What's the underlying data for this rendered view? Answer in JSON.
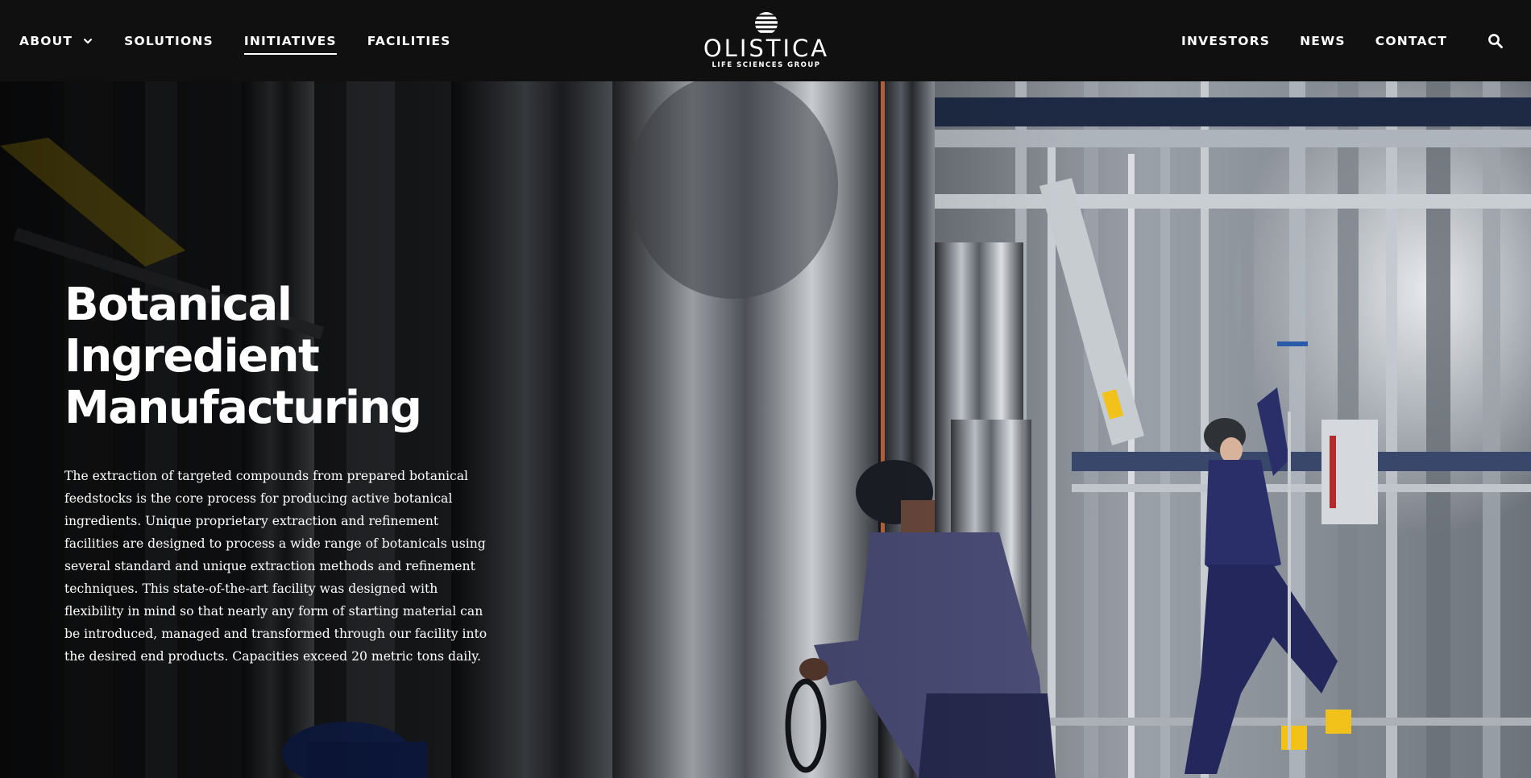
{
  "nav": {
    "left": [
      {
        "label": "ABOUT",
        "has_dropdown": true
      },
      {
        "label": "SOLUTIONS"
      },
      {
        "label": "INITIATIVES",
        "active": true
      },
      {
        "label": "FACILITIES"
      }
    ],
    "right": [
      {
        "label": "INVESTORS"
      },
      {
        "label": "NEWS"
      },
      {
        "label": "CONTACT"
      }
    ],
    "search_icon": "search-icon"
  },
  "logo": {
    "name": "OLISTICA",
    "tagline": "LIFE SCIENCES GROUP"
  },
  "hero": {
    "title_lines": [
      "Botanical",
      "Ingredient",
      "Manufacturing"
    ],
    "body": "The extraction of targeted compounds from prepared botanical feedstocks is the core process for producing active botanical ingredients. Unique proprietary extraction and refinement facilities are designed to process a wide range of botanicals using several standard and unique extraction methods and refinement techniques. This state-of-the-art facility was designed with flexibility in mind so that nearly any form of starting material can be introduced, managed and transformed through our facility into the desired end products. Capacities exceed 20 metric tons daily.",
    "background_image": "industrial extraction facility with stainless steel tanks and pipes, two workers"
  },
  "colors": {
    "header_bg": "#111011",
    "text": "#ffffff",
    "steel": "#8a8f96",
    "workwear": "#2c2c5a",
    "accent_yellow": "#f2c21b"
  }
}
